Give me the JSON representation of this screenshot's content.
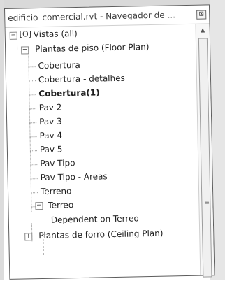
{
  "window": {
    "title": "edificio_comercial.rvt - Navegador de ...",
    "close_glyph": "⊠"
  },
  "tree": {
    "root": {
      "label": "Vistas (all)",
      "expander": "−"
    },
    "floor_plans": {
      "label": "Plantas de piso (Floor Plan)",
      "expander": "−",
      "items": [
        "Cobertura",
        "Cobertura - detalhes",
        "Cobertura(1)",
        "Pav 2",
        "Pav 3",
        "Pav 4",
        "Pav 5",
        "Pav Tipo",
        "Pav Tipo - Areas",
        "Terreno"
      ],
      "selected_item": "Cobertura(1)",
      "terreo": {
        "label": "Terreo",
        "expander": "−",
        "child": "Dependent on Terreo"
      }
    },
    "ceiling_plans": {
      "label": "Plantas de forro (Ceiling Plan)",
      "expander": "+"
    }
  }
}
